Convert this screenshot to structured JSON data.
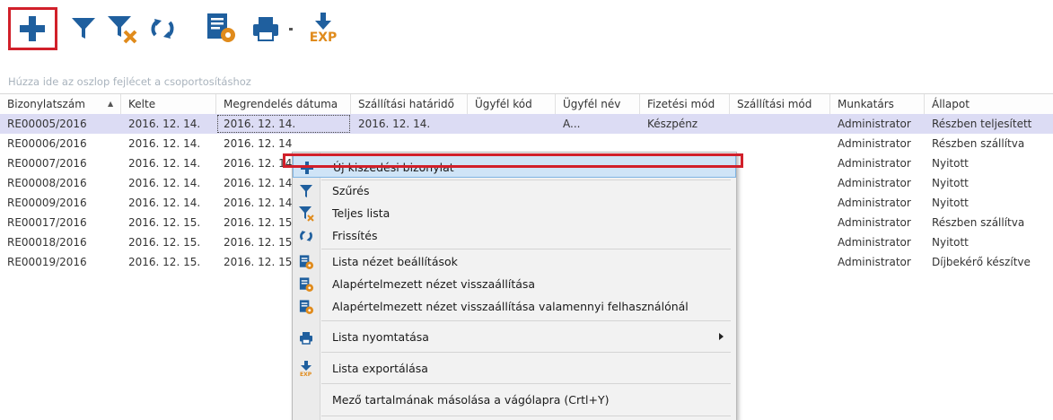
{
  "toolbar": {
    "buttons": [
      {
        "name": "add-button",
        "icon": "plus-icon"
      },
      {
        "name": "filter-button",
        "icon": "funnel-icon"
      },
      {
        "name": "clear-filter-button",
        "icon": "funnel-clear-icon"
      },
      {
        "name": "refresh-button",
        "icon": "refresh-icon"
      },
      {
        "name": "list-settings-button",
        "icon": "settings-list-icon"
      },
      {
        "name": "print-button",
        "icon": "printer-icon"
      },
      {
        "name": "export-button",
        "icon": "export-icon",
        "label": "EXP"
      }
    ]
  },
  "group_hint": "Húzza ide az oszlop fejlécet a csoportosításhoz",
  "grid": {
    "columns": [
      "Bizonylatszám",
      "Kelte",
      "Megrendelés dátuma",
      "Szállítási határidő",
      "Ügyfél kód",
      "Ügyfél név",
      "Fizetési mód",
      "Szállítási mód",
      "Munkatárs",
      "Állapot"
    ],
    "sorted_column": "Bizonylatszám",
    "rows": [
      {
        "id": "RE00005/2016",
        "kelte": "2016. 12. 14.",
        "megr": "2016. 12. 14.",
        "szall": "2016. 12. 14.",
        "ugyfel_kod": "",
        "ugyfel_nev": "A...",
        "fizetes": "Készpénz",
        "szall_mod": "",
        "munkatars": "Administrator",
        "allapot": "Részben teljesített"
      },
      {
        "id": "RE00006/2016",
        "kelte": "2016. 12. 14.",
        "megr": "2016. 12. 14",
        "szall": "",
        "ugyfel_kod": "",
        "ugyfel_nev": "",
        "fizetes": "",
        "szall_mod": "",
        "munkatars": "Administrator",
        "allapot": "Részben szállítva"
      },
      {
        "id": "RE00007/2016",
        "kelte": "2016. 12. 14.",
        "megr": "2016. 12. 14.",
        "szall": "",
        "ugyfel_kod": "",
        "ugyfel_nev": "",
        "fizetes": "",
        "szall_mod": "",
        "munkatars": "Administrator",
        "allapot": "Nyitott"
      },
      {
        "id": "RE00008/2016",
        "kelte": "2016. 12. 14.",
        "megr": "2016. 12. 14.",
        "szall": "",
        "ugyfel_kod": "",
        "ugyfel_nev": "",
        "fizetes": "",
        "szall_mod": "",
        "munkatars": "Administrator",
        "allapot": "Nyitott"
      },
      {
        "id": "RE00009/2016",
        "kelte": "2016. 12. 14.",
        "megr": "2016. 12. 14.",
        "szall": "",
        "ugyfel_kod": "",
        "ugyfel_nev": "",
        "fizetes": "",
        "szall_mod": "",
        "munkatars": "Administrator",
        "allapot": "Nyitott"
      },
      {
        "id": "RE00017/2016",
        "kelte": "2016. 12. 15.",
        "megr": "2016. 12. 15.",
        "szall": "",
        "ugyfel_kod": "",
        "ugyfel_nev": "",
        "fizetes": "",
        "szall_mod": "",
        "munkatars": "Administrator",
        "allapot": "Részben szállítva"
      },
      {
        "id": "RE00018/2016",
        "kelte": "2016. 12. 15.",
        "megr": "2016. 12. 15.",
        "szall": "",
        "ugyfel_kod": "",
        "ugyfel_nev": "",
        "fizetes": "",
        "szall_mod": "",
        "munkatars": "Administrator",
        "allapot": "Nyitott"
      },
      {
        "id": "RE00019/2016",
        "kelte": "2016. 12. 15.",
        "megr": "2016. 12. 15.",
        "szall": "",
        "ugyfel_kod": "",
        "ugyfel_nev": "",
        "fizetes": "",
        "szall_mod": "",
        "munkatars": "Administrator",
        "allapot": "Díjbekérő készítve"
      }
    ]
  },
  "context_menu": {
    "items": [
      {
        "label": "Új kiszedési bizonylat",
        "icon": "plus-icon"
      },
      {
        "label": "Szűrés",
        "icon": "funnel-icon"
      },
      {
        "label": "Teljes lista",
        "icon": "funnel-clear-icon"
      },
      {
        "label": "Frissítés",
        "icon": "refresh-icon"
      },
      {
        "label": "Lista nézet beállítások",
        "icon": "settings-list-icon"
      },
      {
        "label": "Alapértelmezett nézet visszaállítása",
        "icon": "settings-list-icon"
      },
      {
        "label": "Alapértelmezett nézet visszaállítása valamennyi felhasználónál",
        "icon": "settings-list-icon"
      },
      {
        "label": "Lista nyomtatása",
        "icon": "printer-icon"
      },
      {
        "label": "Lista exportálása",
        "icon": "export-icon"
      },
      {
        "label": "Mező tartalmának másolása a vágólapra (Crtl+Y)",
        "icon": ""
      }
    ]
  },
  "colors": {
    "highlight_red": "#d1202a",
    "icon_blue": "#1f5f9e",
    "selected_row": "#dcdcf4",
    "menu_hover": "#cfe4f7"
  }
}
